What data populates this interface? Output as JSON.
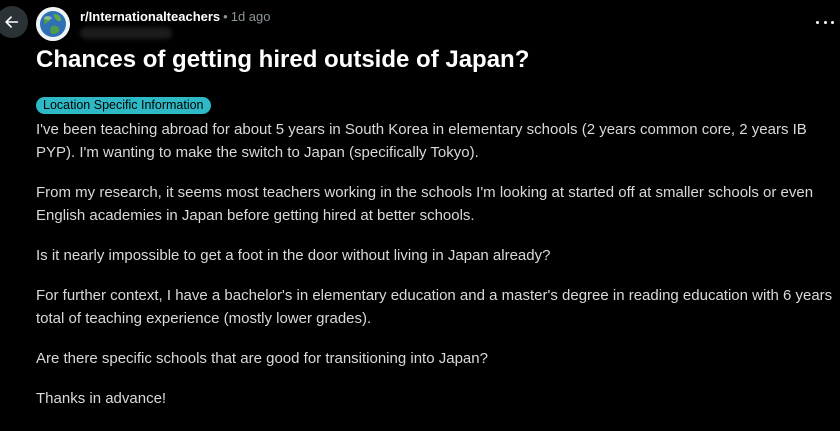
{
  "post": {
    "subreddit": "r/Internationalteachers",
    "separator": "•",
    "age": "1d ago",
    "title": "Chances of getting hired outside of Japan?",
    "flair": "Location Specific Information",
    "paragraphs": [
      "I've been teaching abroad for about 5 years in South Korea in elementary schools (2 years common core, 2 years IB PYP). I'm wanting to make the switch to Japan (specifically Tokyo).",
      "From my research, it seems most teachers working in the schools I'm looking at started off at smaller schools or even English academies in Japan before getting hired at better schools.",
      "Is it nearly impossible to get a foot in the door without living in Japan already?",
      "For further context, I have a bachelor's in elementary education and a master's degree in reading education with 6 years total of teaching experience (mostly lower grades).",
      "Are there specific schools that are good for transitioning into Japan?",
      "Thanks in advance!"
    ]
  },
  "icons": {
    "back": "arrow-left-icon",
    "more": "more-horizontal-icon",
    "avatar": "globe-icon"
  },
  "colors": {
    "background": "#000000",
    "flair_bg": "#2dbac6",
    "title": "#ffffff",
    "body_text": "#d7dadc",
    "muted": "#8b9598",
    "back_button_bg": "#2a3236"
  }
}
